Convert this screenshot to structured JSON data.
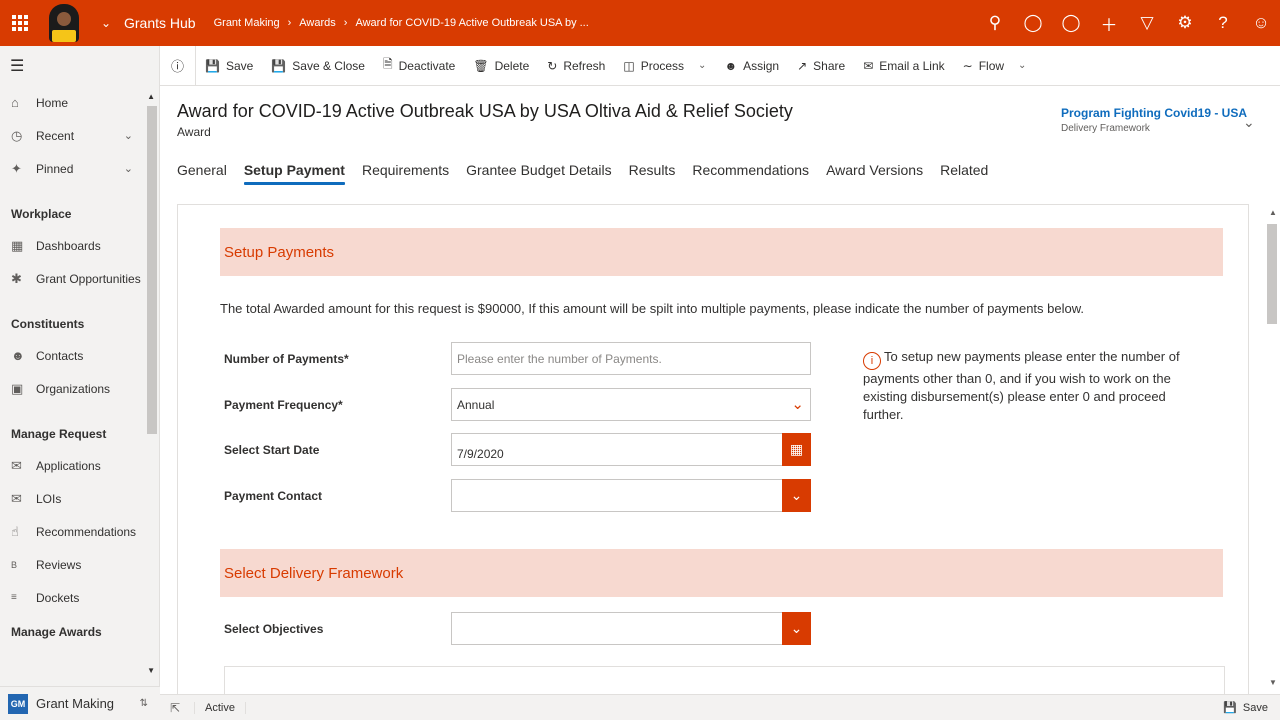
{
  "topbar": {
    "app_title": "Grants Hub",
    "breadcrumbs": [
      "Grant Making",
      "Awards",
      "Award for COVID-19 Active Outbreak USA by ..."
    ],
    "icons": [
      "search-icon",
      "task-icon",
      "lightbulb-icon",
      "plus-icon",
      "filter-icon",
      "settings-icon",
      "help-icon",
      "user-icon"
    ],
    "accent": "#d83b01"
  },
  "sidebar": {
    "items_top": [
      {
        "label": "Home",
        "icon": "home-icon"
      },
      {
        "label": "Recent",
        "icon": "clock-icon"
      },
      {
        "label": "Pinned",
        "icon": "pin-icon"
      }
    ],
    "groups": [
      {
        "title": "Workplace",
        "items": [
          {
            "label": "Dashboards",
            "icon": "dashboard-icon"
          },
          {
            "label": "Grant Opportunities",
            "icon": "grant-icon"
          }
        ]
      },
      {
        "title": "Constituents",
        "items": [
          {
            "label": "Contacts",
            "icon": "contact-icon"
          },
          {
            "label": "Organizations",
            "icon": "organization-icon"
          }
        ]
      },
      {
        "title": "Manage Request",
        "items": [
          {
            "label": "Applications",
            "icon": "application-icon"
          },
          {
            "label": "LOIs",
            "icon": "loi-icon"
          },
          {
            "label": "Recommendations",
            "icon": "thumbs-up-icon"
          },
          {
            "label": "Reviews",
            "icon": "review-icon"
          },
          {
            "label": "Dockets",
            "icon": "docket-icon"
          }
        ]
      },
      {
        "title": "Manage Awards",
        "items": []
      }
    ],
    "area_badge": "GM",
    "area_label": "Grant Making"
  },
  "commands": [
    "Save",
    "Save & Close",
    "Deactivate",
    "Delete",
    "Refresh",
    "Process",
    "Assign",
    "Share",
    "Email a Link",
    "Flow"
  ],
  "record": {
    "title": "Award for COVID-19 Active Outbreak USA by USA Oltiva Aid & Relief Society",
    "entity": "Award",
    "bpf_title": "Program Fighting Covid19 - USA",
    "bpf_stage": "Delivery Framework"
  },
  "tabs": [
    "General",
    "Setup Payment",
    "Requirements",
    "Grantee Budget Details",
    "Results",
    "Recommendations",
    "Award Versions",
    "Related"
  ],
  "active_tab": "Setup Payment",
  "setup_payments": {
    "heading": "Setup Payments",
    "intro": "The total Awarded amount for this request is $90000, If this amount will be spilt into multiple payments, please indicate the number of payments below.",
    "fields": {
      "num_label": "Number of Payments*",
      "num_placeholder": "Please enter the number of Payments.",
      "freq_label": "Payment Frequency*",
      "freq_value": "Annual",
      "start_label": "Select Start Date",
      "start_value": "7/9/2020",
      "contact_label": "Payment Contact",
      "contact_value": ""
    },
    "info": "To setup new payments please enter the number of payments other than 0, and if you wish to work on the existing disbursement(s) please enter 0 and proceed further."
  },
  "delivery": {
    "heading": "Select Delivery Framework",
    "objectives_label": "Select Objectives",
    "objectives_value": ""
  },
  "status": {
    "state": "Active",
    "save_label": "Save"
  }
}
